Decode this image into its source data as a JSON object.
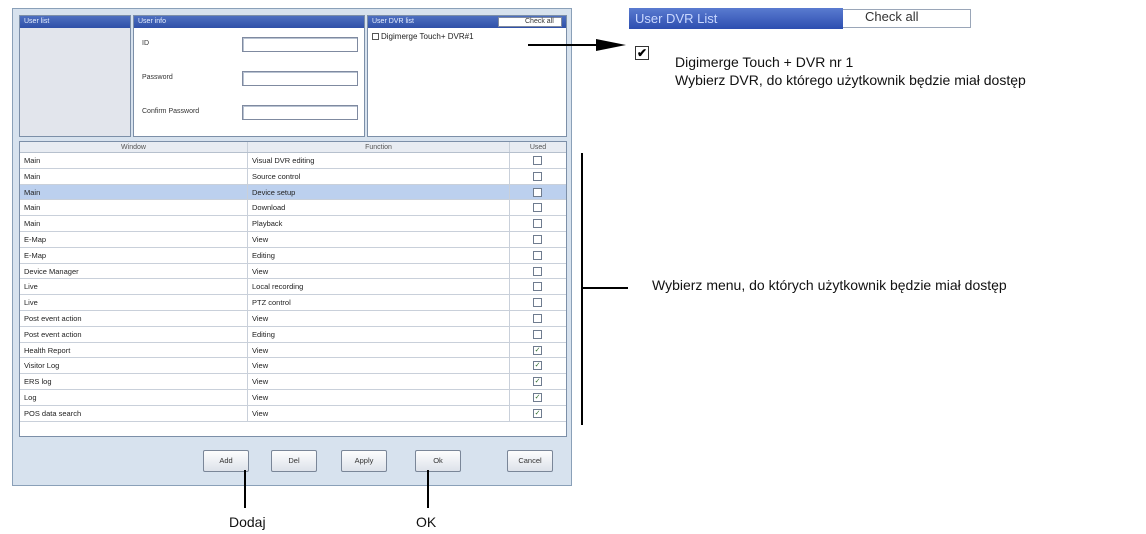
{
  "user_list": {
    "header": "User list"
  },
  "user_info": {
    "header": "User info",
    "id_label": "ID",
    "password_label": "Password",
    "confirm_label": "Confirm Password"
  },
  "dvr_list": {
    "header": "User DVR list",
    "check_all": "Check all",
    "items": [
      "Digimerge Touch+ DVR#1"
    ]
  },
  "grid": {
    "headers": [
      "Window",
      "Function",
      "Used"
    ],
    "rows": [
      {
        "window": "Main",
        "function": "Visual DVR editing",
        "checked": false,
        "selected": false
      },
      {
        "window": "Main",
        "function": "Source control",
        "checked": false,
        "selected": false
      },
      {
        "window": "Main",
        "function": "Device setup",
        "checked": false,
        "selected": true
      },
      {
        "window": "Main",
        "function": "Download",
        "checked": false,
        "selected": false
      },
      {
        "window": "Main",
        "function": "Playback",
        "checked": false,
        "selected": false
      },
      {
        "window": "E-Map",
        "function": "View",
        "checked": false,
        "selected": false
      },
      {
        "window": "E-Map",
        "function": "Editing",
        "checked": false,
        "selected": false
      },
      {
        "window": "Device Manager",
        "function": "View",
        "checked": false,
        "selected": false
      },
      {
        "window": "Live",
        "function": "Local recording",
        "checked": false,
        "selected": false
      },
      {
        "window": "Live",
        "function": "PTZ control",
        "checked": false,
        "selected": false
      },
      {
        "window": "Post event action",
        "function": "View",
        "checked": false,
        "selected": false
      },
      {
        "window": "Post event action",
        "function": "Editing",
        "checked": false,
        "selected": false
      },
      {
        "window": "Health Report",
        "function": "View",
        "checked": true,
        "selected": false
      },
      {
        "window": "Visitor Log",
        "function": "View",
        "checked": true,
        "selected": false
      },
      {
        "window": "ERS log",
        "function": "View",
        "checked": true,
        "selected": false
      },
      {
        "window": "Log",
        "function": "View",
        "checked": true,
        "selected": false
      },
      {
        "window": "POS data search",
        "function": "View",
        "checked": true,
        "selected": false
      }
    ]
  },
  "buttons": {
    "add": "Add",
    "delete": "Del",
    "apply": "Apply",
    "ok": "Ok",
    "cancel": "Cancel"
  },
  "zoom": {
    "header": "User DVR List",
    "check_all": "Check all",
    "item": "Digimerge Touch + DVR nr 1",
    "hint": "Wybierz DVR, do którego użytkownik będzie miał dostęp"
  },
  "annotations": {
    "menu_hint": "Wybierz menu, do których użytkownik będzie miał dostęp",
    "add_label": "Dodaj",
    "ok_label": "OK"
  }
}
